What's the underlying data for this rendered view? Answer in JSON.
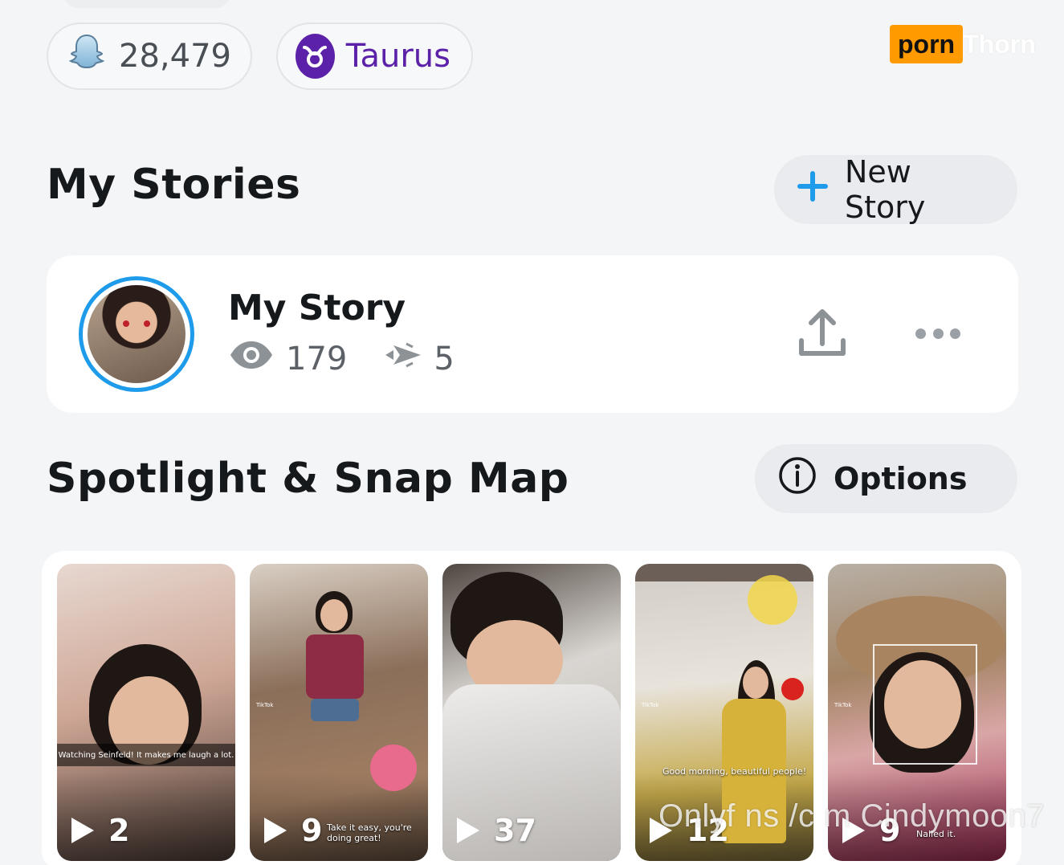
{
  "profile": {
    "snap_score": "28,479",
    "zodiac": "Taurus"
  },
  "brand": {
    "logo_box": "porn",
    "logo_text": "Thorn"
  },
  "my_stories": {
    "title": "My Stories",
    "new_story_label": "New Story",
    "card": {
      "name": "My Story",
      "views": "179",
      "screenshots": "5"
    }
  },
  "spotlight": {
    "title": "Spotlight & Snap Map",
    "options_label": "Options",
    "items": [
      {
        "count": "2",
        "caption": "Watching Seinfeld! It makes me laugh a lot."
      },
      {
        "count": "9",
        "caption": "Take it easy, you're doing great!"
      },
      {
        "count": "37",
        "caption": ""
      },
      {
        "count": "12",
        "caption": "Good morning, beautiful people!"
      },
      {
        "count": "9",
        "caption": "Nailed it."
      }
    ]
  },
  "watermark": "Onlyf ns /c m Cindymoon7",
  "colors": {
    "accent_blue": "#1e9bea",
    "zodiac_purple": "#5b21a8",
    "logo_orange": "#ff9a00"
  },
  "icons": {
    "score": "ghost-icon",
    "zodiac": "taurus-icon",
    "new_story": "plus-icon",
    "views": "eye-icon",
    "screenshots": "screenshot-arrows-icon",
    "share": "upload-icon",
    "more": "more-dots-icon",
    "options": "info-icon",
    "play": "play-icon"
  }
}
